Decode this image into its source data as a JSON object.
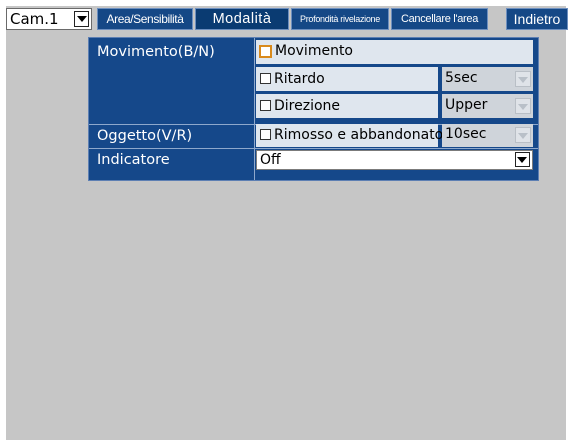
{
  "header": {
    "camera_value": "Cam.1",
    "tabs": [
      {
        "label": "Area/Sensibilità"
      },
      {
        "label": "Modalità"
      },
      {
        "label": "Profondità rivelazione"
      },
      {
        "label": "Cancellare l'area"
      }
    ],
    "back_label": "Indietro",
    "active_tab": "Modalità"
  },
  "settings": {
    "movement": {
      "label": "Movimento(B/N)",
      "option_movement": "Movimento",
      "option_delay": "Ritardo",
      "delay_value": "5sec",
      "option_direction": "Direzione",
      "direction_value": "Upper"
    },
    "object": {
      "label": "Oggetto(V/R)",
      "option_removed": "Rimosso e abbandonato",
      "removed_value": "10sec"
    },
    "indicator": {
      "label": "Indicatore",
      "value": "Off"
    }
  },
  "colors": {
    "panel": "#15488a",
    "tab": "#154886",
    "background": "#c6c6c6",
    "checkbox_highlight": "#d98a1c"
  }
}
